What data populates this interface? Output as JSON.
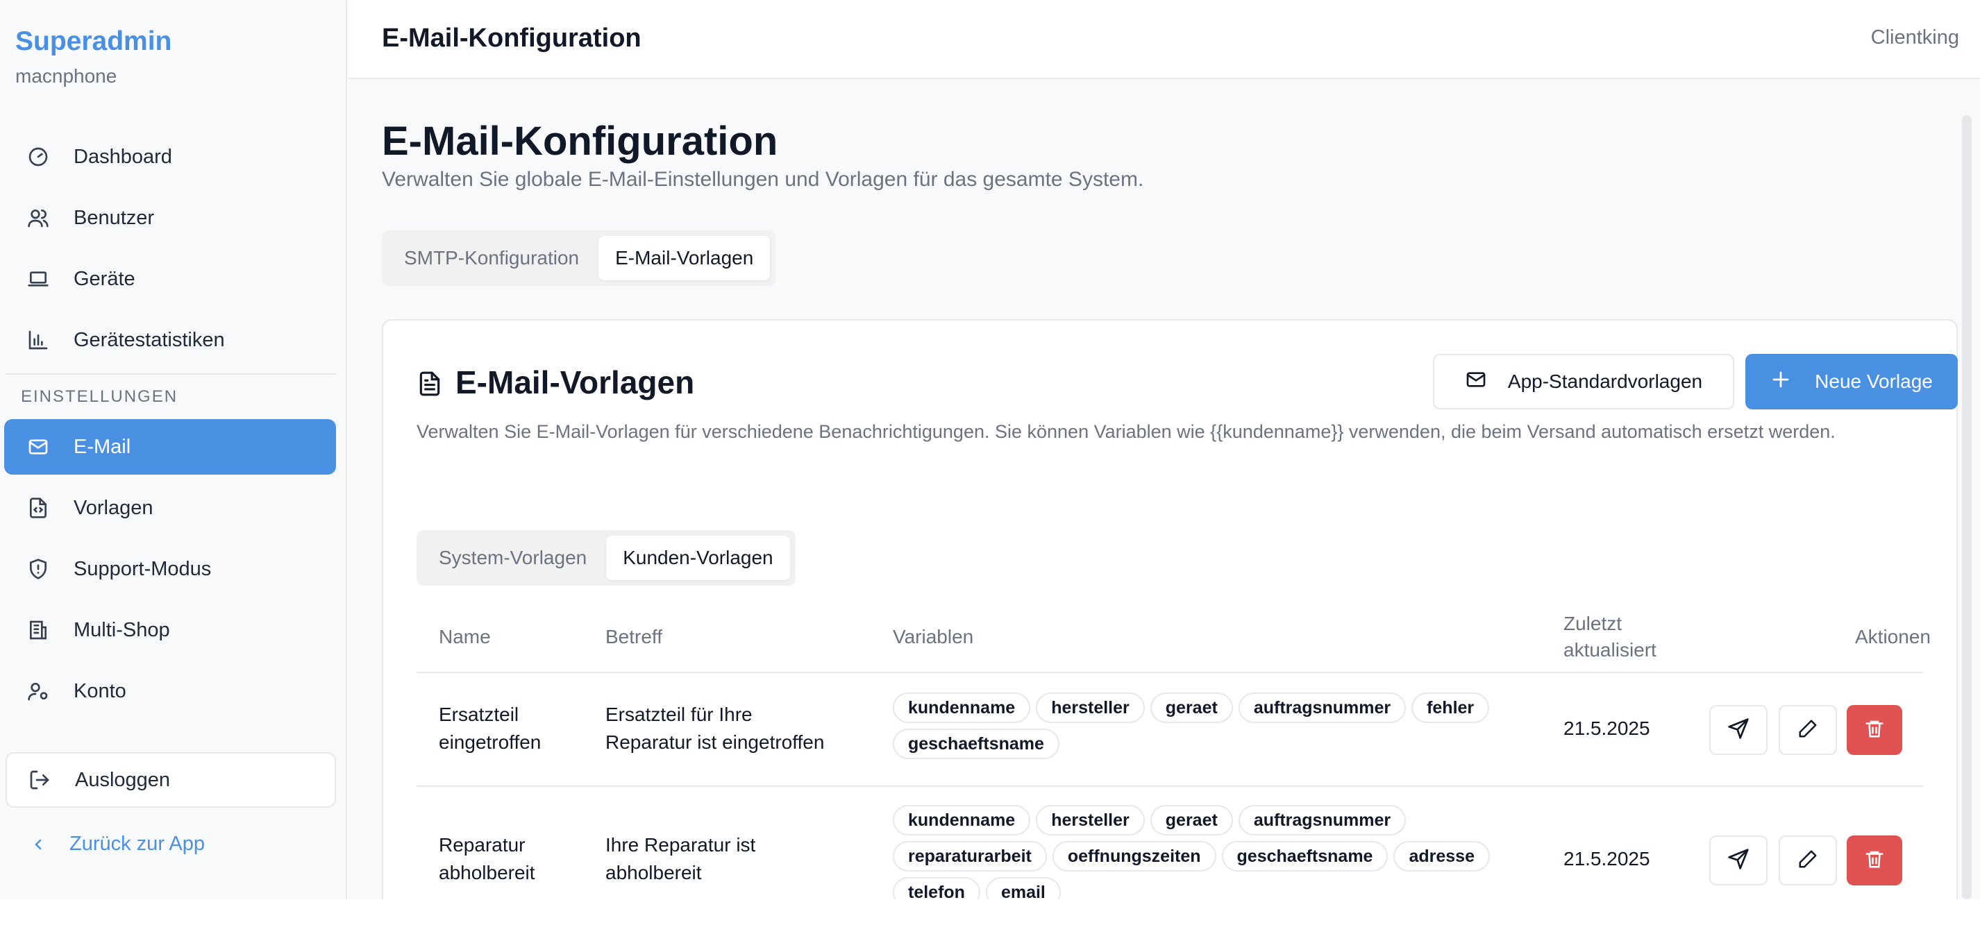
{
  "sidebar": {
    "brand_title": "Superadmin",
    "brand_subtitle": "macnphone",
    "items": [
      {
        "label": "Dashboard",
        "icon": "gauge-icon"
      },
      {
        "label": "Benutzer",
        "icon": "users-icon"
      },
      {
        "label": "Geräte",
        "icon": "laptop-icon"
      },
      {
        "label": "Gerätestatistiken",
        "icon": "bar-chart-icon"
      }
    ],
    "section_label": "EINSTELLUNGEN",
    "settings_items": [
      {
        "label": "E-Mail",
        "icon": "mail-icon",
        "active": true
      },
      {
        "label": "Vorlagen",
        "icon": "file-code-icon"
      },
      {
        "label": "Support-Modus",
        "icon": "shield-icon"
      },
      {
        "label": "Multi-Shop",
        "icon": "building-icon"
      },
      {
        "label": "Konto",
        "icon": "user-cog-icon"
      }
    ],
    "logout_label": "Ausloggen",
    "back_label": "Zurück zur App"
  },
  "header": {
    "title": "E-Mail-Konfiguration",
    "user": "Clientking"
  },
  "main": {
    "title": "E-Mail-Konfiguration",
    "description": "Verwalten Sie globale E-Mail-Einstellungen und Vorlagen für das gesamte System.",
    "tabs": [
      "SMTP-Konfiguration",
      "E-Mail-Vorlagen"
    ],
    "active_tab": "E-Mail-Vorlagen"
  },
  "card": {
    "title": "E-Mail-Vorlagen",
    "description": "Verwalten Sie E-Mail-Vorlagen für verschiedene Benachrichtigungen. Sie können Variablen wie {{kundenname}} verwenden, die beim Versand automatisch ersetzt werden.",
    "btn_defaults": "App-Standardvorlagen",
    "btn_new": "Neue Vorlage",
    "subtabs": [
      "System-Vorlagen",
      "Kunden-Vorlagen"
    ],
    "active_subtab": "Kunden-Vorlagen",
    "columns": {
      "name": "Name",
      "subject": "Betreff",
      "variables": "Variablen",
      "updated_line1": "Zuletzt",
      "updated_line2": "aktualisiert",
      "actions": "Aktionen"
    },
    "rows": [
      {
        "name_line1": "Ersatzteil",
        "name_line2": "eingetroffen",
        "subject_line1": "Ersatzteil für Ihre",
        "subject_line2": "Reparatur ist eingetroffen",
        "variables": [
          "kundenname",
          "hersteller",
          "geraet",
          "auftragsnummer",
          "fehler",
          "geschaeftsname"
        ],
        "updated": "21.5.2025"
      },
      {
        "name_line1": "Reparatur",
        "name_line2": "abholbereit",
        "subject_line1": "Ihre Reparatur ist",
        "subject_line2": "abholbereit",
        "variables": [
          "kundenname",
          "hersteller",
          "geraet",
          "auftragsnummer",
          "reparaturarbeit",
          "oeffnungszeiten",
          "geschaeftsname",
          "adresse",
          "telefon",
          "email"
        ],
        "updated": "21.5.2025"
      }
    ]
  },
  "colors": {
    "accent": "#4a90e2",
    "danger": "#e05252"
  }
}
